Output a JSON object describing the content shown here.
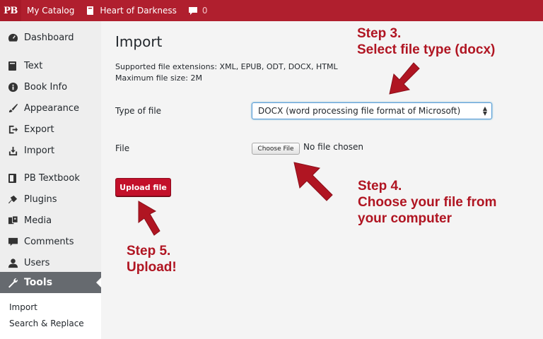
{
  "topbar": {
    "logo": "PB",
    "catalog": "My Catalog",
    "book": "Heart of Darkness",
    "comments": "0",
    "brand_color": "#b01f2e"
  },
  "sidebar": {
    "items": [
      {
        "label": "Dashboard",
        "icon": "dashboard-icon"
      },
      {
        "label": "Text",
        "icon": "book-icon"
      },
      {
        "label": "Book Info",
        "icon": "info-icon"
      },
      {
        "label": "Appearance",
        "icon": "brush-icon"
      },
      {
        "label": "Export",
        "icon": "export-icon"
      },
      {
        "label": "Import",
        "icon": "import-icon"
      },
      {
        "label": "PB Textbook",
        "icon": "textbook-icon"
      },
      {
        "label": "Plugins",
        "icon": "plug-icon"
      },
      {
        "label": "Media",
        "icon": "media-icon"
      },
      {
        "label": "Comments",
        "icon": "comment-icon"
      },
      {
        "label": "Users",
        "icon": "user-icon"
      },
      {
        "label": "Tools",
        "icon": "wrench-icon",
        "active": true
      }
    ],
    "submenu": [
      "Import",
      "Search & Replace"
    ]
  },
  "main": {
    "title": "Import",
    "extensions": "Supported file extensions: XML, EPUB, ODT, DOCX, HTML",
    "max_size": "Maximum file size: 2M",
    "type_label": "Type of file",
    "type_value": "DOCX (word processing file format of Microsoft)",
    "file_label": "File",
    "choose_label": "Choose File",
    "no_file": "No file chosen",
    "upload_label": "Upload file"
  },
  "annotations": {
    "step3_line1": "Step 3.",
    "step3_line2": "Select file type (docx)",
    "step4_line1": "Step 4.",
    "step4_line2": "Choose your file from",
    "step4_line3": "your computer",
    "step5_line1": "Step 5.",
    "step5_line2": "Upload!",
    "color": "#b01522"
  }
}
